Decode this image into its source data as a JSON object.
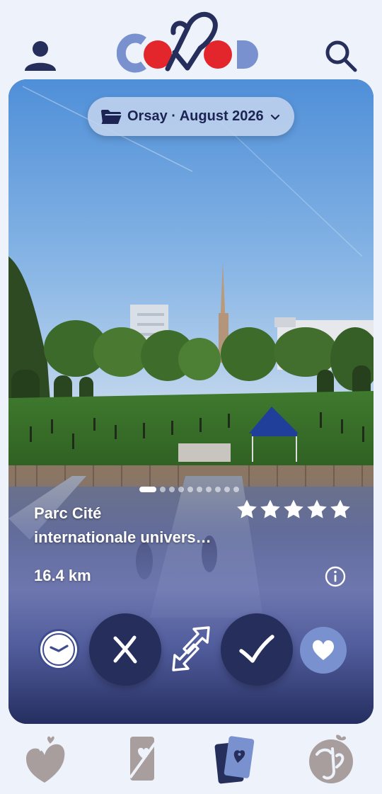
{
  "header": {
    "logo_text": "COMOD",
    "profile_icon": "person-icon",
    "search_icon": "search-icon"
  },
  "card": {
    "folder": {
      "label": "Orsay · August 2026",
      "icon": "folder-icon"
    },
    "photo_page": {
      "current": 1,
      "total": 10
    },
    "place": {
      "name_line1": "Parc Cité",
      "name_line2": "internationale univers…",
      "rating": 5,
      "rating_max": 5,
      "distance": "16.4 km"
    },
    "actions": {
      "later_icon": "clock-icon",
      "reject_icon": "close-icon",
      "swap_icon": "swap-icon",
      "accept_icon": "check-icon",
      "favorite_icon": "heart-icon"
    }
  },
  "bottom_nav": {
    "items": [
      {
        "icon": "hearts-icon",
        "active": false
      },
      {
        "icon": "card-slash-icon",
        "active": false
      },
      {
        "icon": "cards-icon",
        "active": true
      },
      {
        "icon": "profile-heart-icon",
        "active": false
      }
    ]
  },
  "colors": {
    "background": "#eef2fb",
    "primary_dark": "#262e5c",
    "accent_blue": "#7a91cf",
    "logo_red": "#e3262b",
    "nav_inactive": "#a89e9e"
  }
}
